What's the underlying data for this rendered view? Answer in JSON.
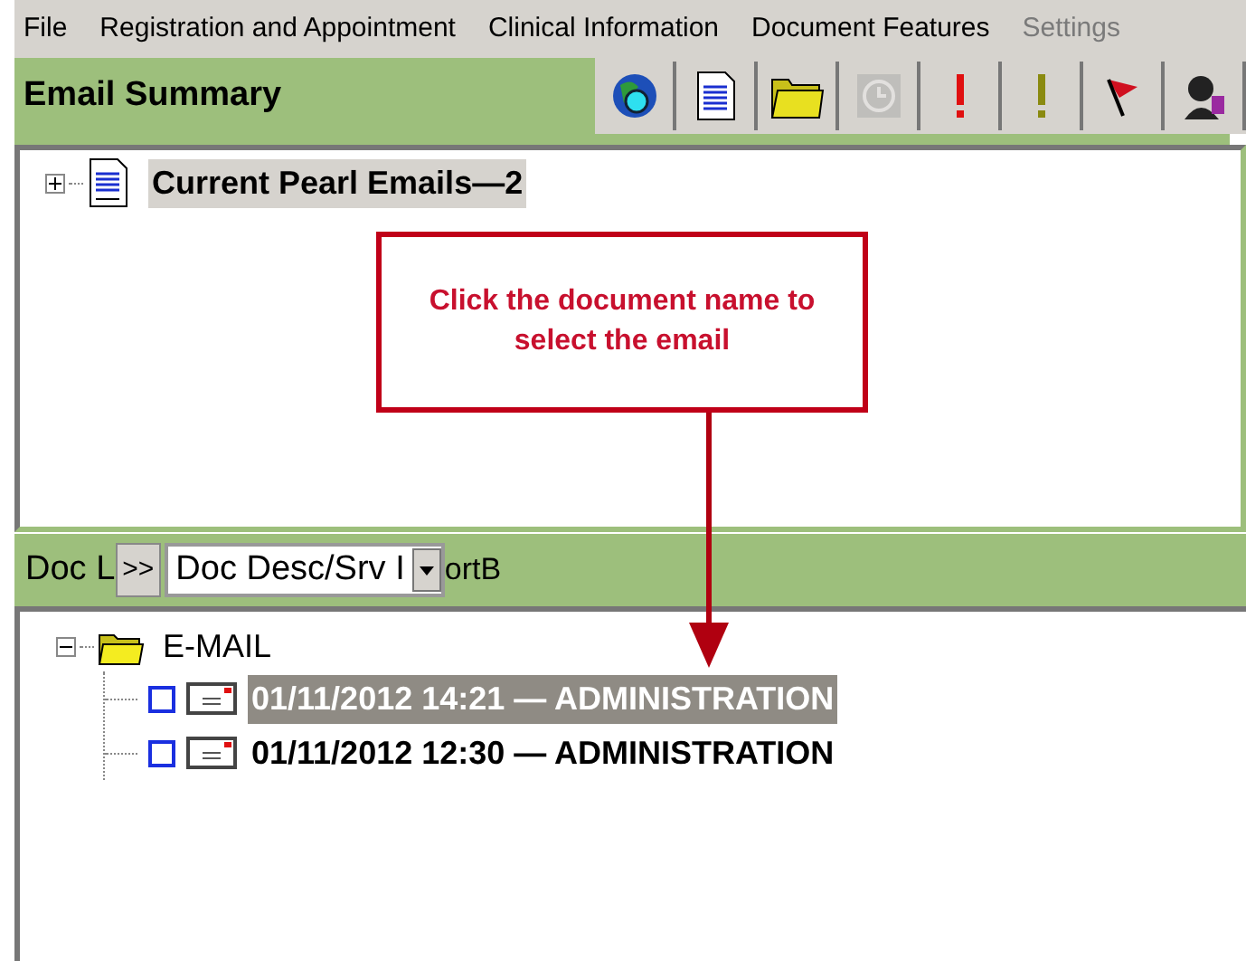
{
  "menu": [
    {
      "label": "File",
      "disabled": false
    },
    {
      "label": "Registration and Appointment",
      "disabled": false
    },
    {
      "label": "Clinical Information",
      "disabled": false
    },
    {
      "label": "Document Features",
      "disabled": false
    },
    {
      "label": "Settings",
      "disabled": true
    }
  ],
  "header": {
    "title": "Email Summary"
  },
  "toolbar": [
    {
      "kind": "globe",
      "disabled": false
    },
    {
      "kind": "document",
      "disabled": false
    },
    {
      "kind": "folder",
      "disabled": false
    },
    {
      "kind": "clock",
      "disabled": true
    },
    {
      "kind": "alert-red",
      "disabled": false
    },
    {
      "kind": "alert-olive",
      "disabled": false
    },
    {
      "kind": "flag",
      "disabled": false
    },
    {
      "kind": "person",
      "disabled": false
    }
  ],
  "summary_tree": [
    {
      "label": "Current Pearl Emails—2",
      "expanded": false,
      "selected": true
    }
  ],
  "doc_bar": {
    "label": "Doc L",
    "expand_button": ">>",
    "sort_value": "Doc Desc/Srv I",
    "sort_label": "ortB"
  },
  "doc_tree": [
    {
      "label": "E-MAIL",
      "expanded": true,
      "children": [
        {
          "label": "01/11/2012 14:21 — ADMINISTRATION",
          "selected": true,
          "checked": false
        },
        {
          "label": "01/11/2012 12:30 — ADMINISTRATION",
          "selected": false,
          "checked": false
        }
      ]
    }
  ],
  "callout": {
    "text": "Click the document name to select the email"
  }
}
